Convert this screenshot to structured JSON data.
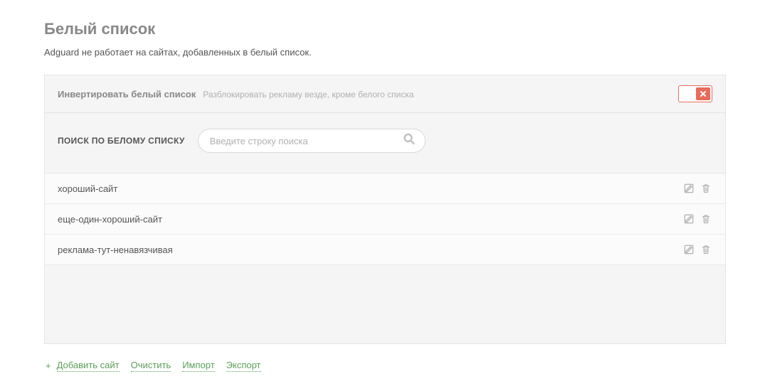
{
  "page": {
    "title": "Белый список",
    "description": "Adguard не работает на сайтах, добавленных в белый список."
  },
  "invert": {
    "label": "Инвертировать белый список",
    "description": "Разблокировать рекламу везде, кроме белого списка",
    "state": "off"
  },
  "search": {
    "label": "ПОИСК ПО БЕЛОМУ СПИСКУ",
    "placeholder": "Введите строку поиска",
    "value": ""
  },
  "list": {
    "items": [
      {
        "name": "хороший-сайт"
      },
      {
        "name": "еще-один-хороший-сайт"
      },
      {
        "name": "реклама-тут-ненавязчивая"
      }
    ]
  },
  "footer": {
    "add": "Добавить сайт",
    "clear": "Очистить",
    "import": "Импорт",
    "export": "Экспорт"
  }
}
